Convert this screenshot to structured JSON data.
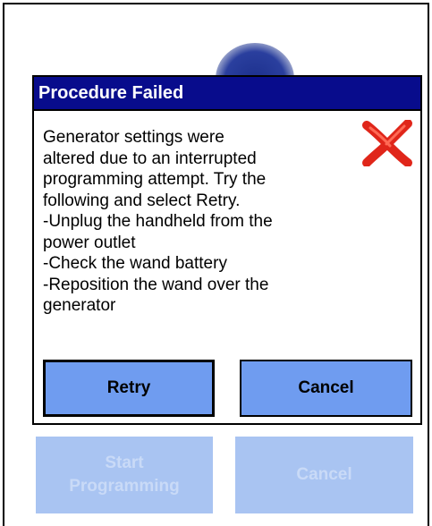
{
  "background": {
    "start_button_label": "Start\nProgramming",
    "cancel_button_label": "Cancel"
  },
  "dialog": {
    "title": "Procedure Failed",
    "message": "Generator settings were\naltered due to an interrupted\nprogramming attempt. Try the\nfollowing and select Retry.\n-Unplug the handheld from the\npower outlet\n-Check the wand battery\n-Reposition the wand over the\ngenerator",
    "icon": "error-x-icon",
    "retry_label": "Retry",
    "cancel_label": "Cancel"
  },
  "colors": {
    "titlebar": "#080c8c",
    "button": "#6f9cf0",
    "disabled_button": "#a9c4f2",
    "error_icon": "#e0261a"
  }
}
